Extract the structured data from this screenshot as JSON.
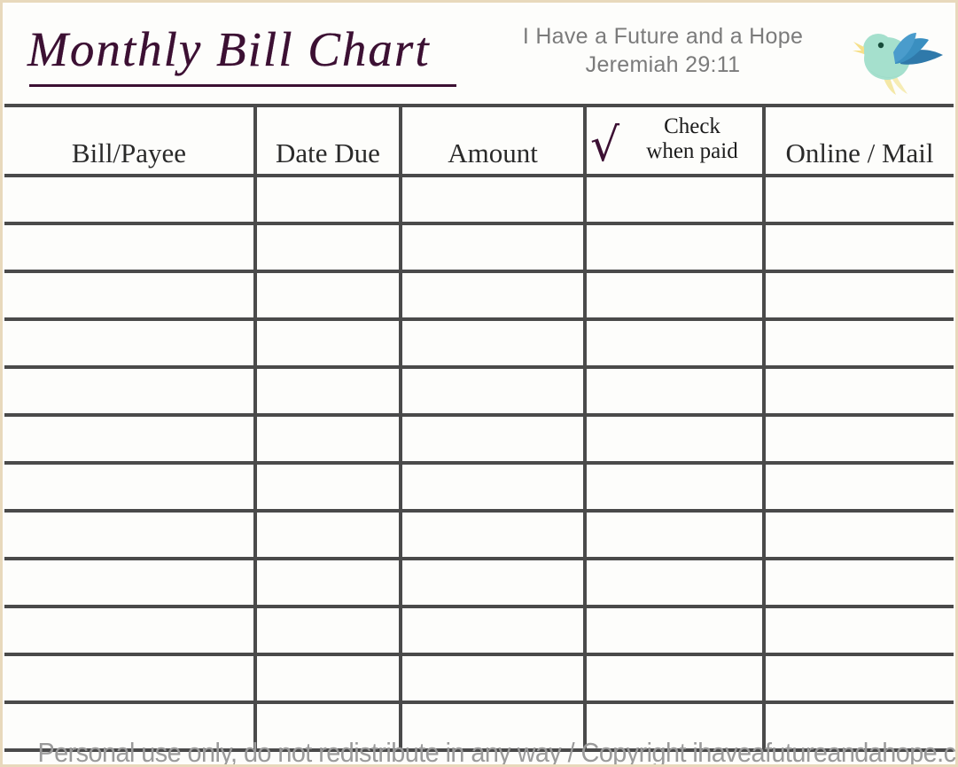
{
  "document": {
    "title": "Monthly Bill Chart",
    "verse_line1": "I Have a Future and a Hope",
    "verse_line2": "Jeremiah 29:11",
    "bird_icon": "bird-icon"
  },
  "table": {
    "columns": [
      {
        "key": "bill",
        "label": "Bill/Payee"
      },
      {
        "key": "date",
        "label": "Date Due"
      },
      {
        "key": "amount",
        "label": "Amount"
      },
      {
        "key": "check",
        "label_line1": "Check",
        "label_line2": "when paid",
        "mark": "√"
      },
      {
        "key": "online",
        "label": "Online / Mail"
      }
    ],
    "row_count": 12,
    "rows": [
      {
        "bill": "",
        "date": "",
        "amount": "",
        "check": "",
        "online": ""
      },
      {
        "bill": "",
        "date": "",
        "amount": "",
        "check": "",
        "online": ""
      },
      {
        "bill": "",
        "date": "",
        "amount": "",
        "check": "",
        "online": ""
      },
      {
        "bill": "",
        "date": "",
        "amount": "",
        "check": "",
        "online": ""
      },
      {
        "bill": "",
        "date": "",
        "amount": "",
        "check": "",
        "online": ""
      },
      {
        "bill": "",
        "date": "",
        "amount": "",
        "check": "",
        "online": ""
      },
      {
        "bill": "",
        "date": "",
        "amount": "",
        "check": "",
        "online": ""
      },
      {
        "bill": "",
        "date": "",
        "amount": "",
        "check": "",
        "online": ""
      },
      {
        "bill": "",
        "date": "",
        "amount": "",
        "check": "",
        "online": ""
      },
      {
        "bill": "",
        "date": "",
        "amount": "",
        "check": "",
        "online": ""
      },
      {
        "bill": "",
        "date": "",
        "amount": "",
        "check": "",
        "online": ""
      },
      {
        "bill": "",
        "date": "",
        "amount": "",
        "check": "",
        "online": ""
      }
    ]
  },
  "footer": {
    "text": "Personal use only, do not redistribute in any way / Copyright ihaveafutureandahope.com"
  },
  "colors": {
    "title": "#3c1033",
    "checkmark": "#3c1033",
    "grid": "#4a4a4a",
    "verse_text": "#7b7b7b",
    "footer_text": "#9a9a9a",
    "page_border": "#e8d9bc",
    "page_background": "#fdfdfb",
    "bird_body": "#a5e0cd",
    "bird_wing": "#3a85b5",
    "bird_beak": "#f6e9a8"
  }
}
